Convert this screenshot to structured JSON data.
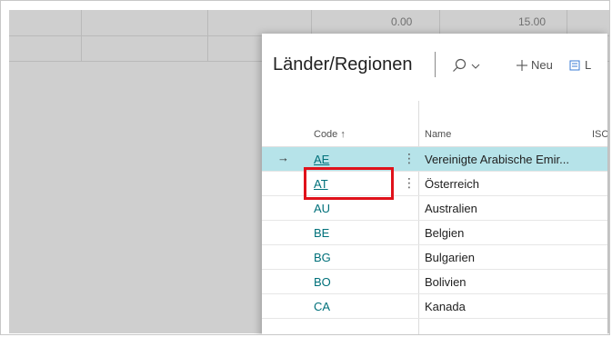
{
  "background": {
    "values": [
      "0.00",
      "15.00"
    ]
  },
  "dialog": {
    "title": "Länder/Regionen",
    "new_label": "Neu",
    "list_label_fragment": "L",
    "columns": {
      "code": "Code ↑",
      "name": "Name",
      "iso": "ISC"
    },
    "rows": [
      {
        "code": "AE",
        "name": "Vereinigte Arabische Emir...",
        "selected": true,
        "arrow": "→"
      },
      {
        "code": "AT",
        "name": "Österreich",
        "selected": false
      },
      {
        "code": "AU",
        "name": "Australien"
      },
      {
        "code": "BE",
        "name": "Belgien"
      },
      {
        "code": "BG",
        "name": "Bulgarien"
      },
      {
        "code": "BO",
        "name": "Bolivien"
      },
      {
        "code": "CA",
        "name": "Kanada"
      }
    ]
  },
  "colors": {
    "selected_row": "#b6e3e9",
    "link": "#00707a",
    "highlight": "#e0121b"
  }
}
